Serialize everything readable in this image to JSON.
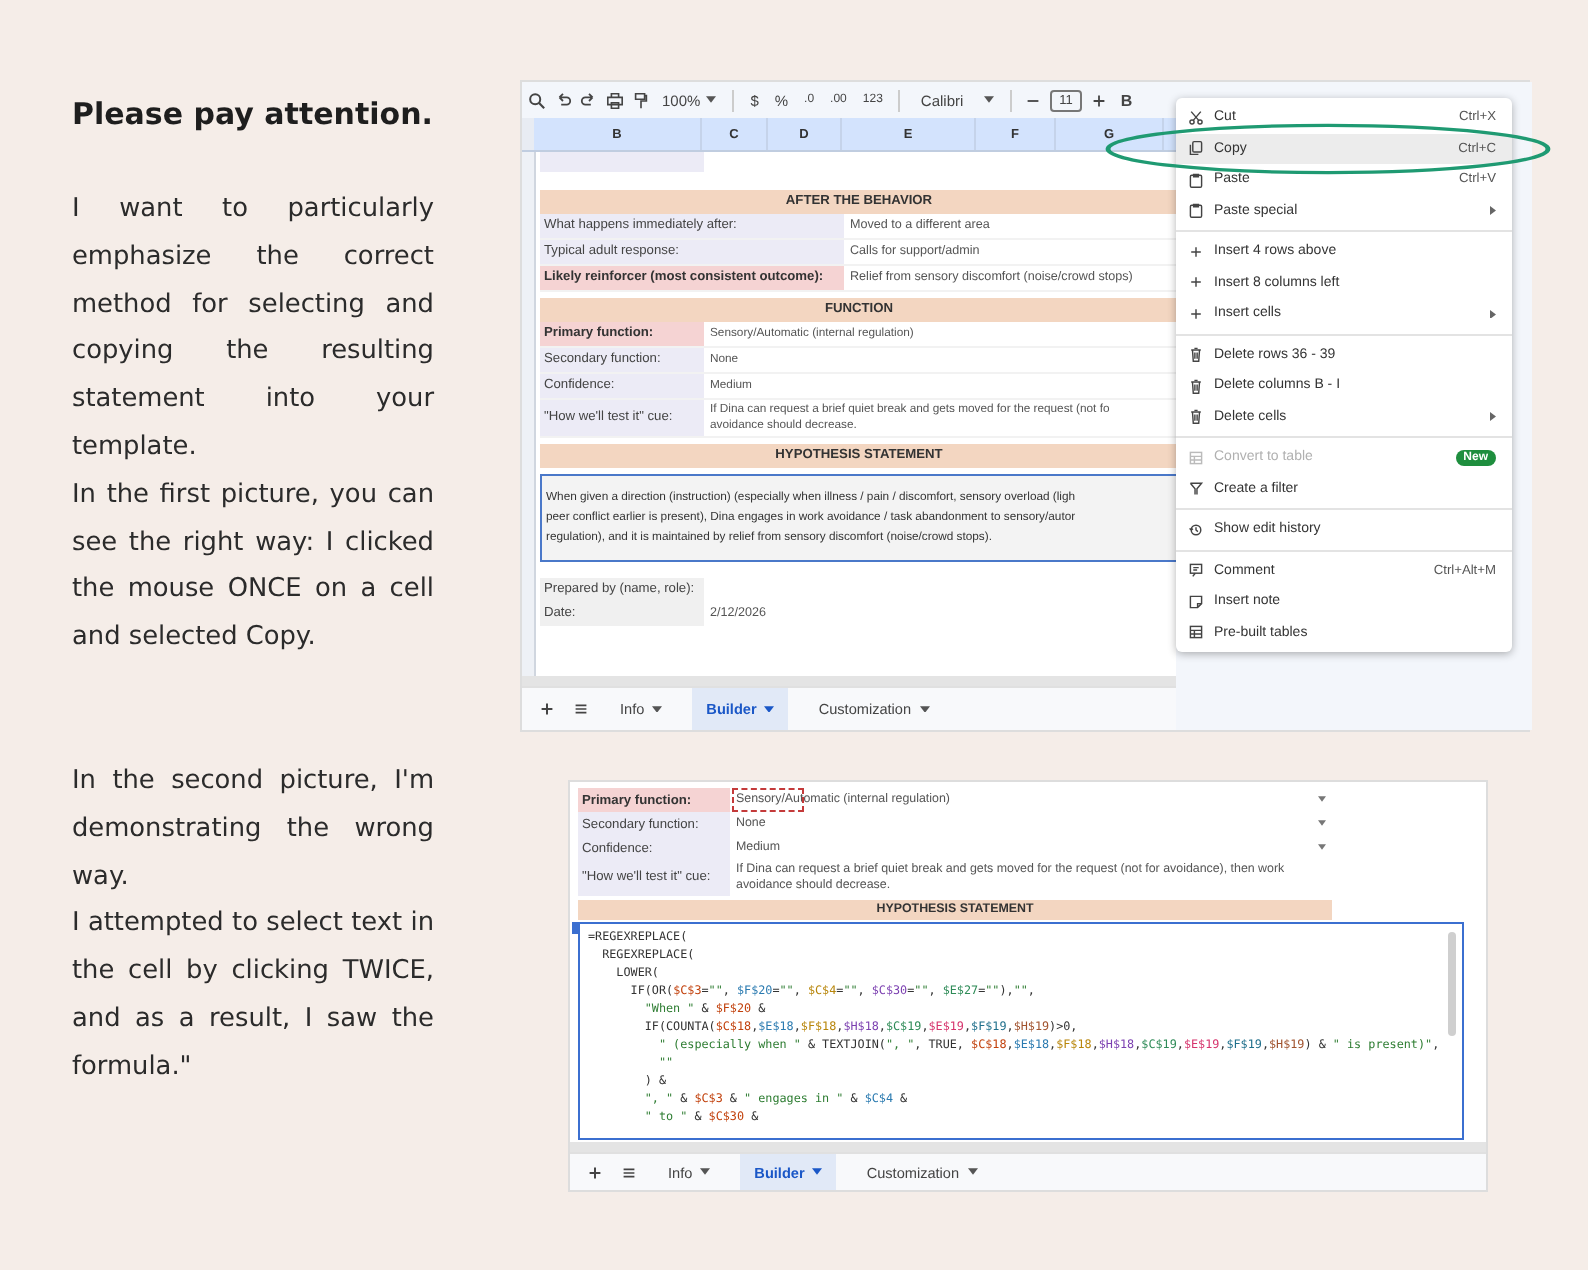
{
  "instructions_top": {
    "heading": "Please pay attention.",
    "paragraphs": [
      "I want to particularly emphasize the correct method for selecting and copying the resulting statement into your template.",
      "In the first picture, you can see the right way: I clicked the mouse ONCE on a cell and selected Copy."
    ]
  },
  "screenshot_1": {
    "toolbar": {
      "zoom": "100%",
      "currency": "$",
      "percent": "%",
      "decrease_decimals": ".0",
      "increase_decimals": ".00",
      "number_format": "123",
      "font": "Calibri",
      "font_size": "11",
      "bold": "B"
    },
    "columns": [
      "B",
      "C",
      "D",
      "E",
      "F",
      "G"
    ],
    "sections": [
      {
        "title": "AFTER THE BEHAVIOR",
        "kind": "wide",
        "rows": [
          {
            "label": "What happens immediately after:",
            "value": "Moved to a different area",
            "highlighted": false
          },
          {
            "label": "Typical adult response:",
            "value": "Calls for support/admin",
            "highlighted": false
          },
          {
            "label": "Likely reinforcer (most consistent outcome):",
            "value": "Relief from sensory discomfort (noise/crowd stops)",
            "highlighted": true
          }
        ]
      },
      {
        "title": "FUNCTION",
        "kind": "narrow",
        "rows": [
          {
            "label": "Primary function:",
            "value": "Sensory/Automatic (internal regulation)",
            "highlighted": true
          },
          {
            "label": "Secondary function:",
            "value": "None",
            "highlighted": false
          },
          {
            "label": "Confidence:",
            "value": "Medium",
            "highlighted": false
          },
          {
            "label": "\"How we'll test it\" cue:",
            "value": "If Dina can request a brief quiet break and gets moved for the request (not fo\navoidance should decrease.",
            "highlighted": false
          }
        ]
      },
      {
        "title": "HYPOTHESIS STATEMENT",
        "kind": "statement",
        "selected": true,
        "lines": [
          "When given a direction (instruction) (especially when illness / pain / discomfort, sensory overload (ligh",
          "peer conflict earlier is present), Dina engages in work avoidance / task abandonment to sensory/autor",
          "regulation), and it is maintained by relief from sensory discomfort (noise/crowd stops)."
        ]
      },
      {
        "kind": "plain",
        "rows": [
          {
            "label": "Prepared by (name, role):"
          },
          {
            "label": "Date:",
            "value": "2/12/2026"
          }
        ]
      }
    ],
    "tabs": [
      {
        "label": "Info",
        "selected": false
      },
      {
        "label": "Builder",
        "selected": true
      },
      {
        "label": "Customization",
        "selected": false
      }
    ],
    "context_menu": {
      "groups": [
        [
          {
            "kind": "cut",
            "label": "Cut",
            "shortcut": "Ctrl+X",
            "submenu": false,
            "disabled": false,
            "selected": false,
            "circled": false
          },
          {
            "kind": "copy",
            "label": "Copy",
            "shortcut": "Ctrl+C",
            "submenu": false,
            "disabled": false,
            "selected": true,
            "circled": true
          },
          {
            "kind": "paste",
            "label": "Paste",
            "shortcut": "Ctrl+V",
            "submenu": false,
            "disabled": false,
            "selected": false,
            "circled": false
          },
          {
            "kind": "paste",
            "label": "Paste special",
            "submenu": true,
            "disabled": false,
            "selected": false,
            "circled": false
          }
        ],
        [
          {
            "kind": "insert",
            "label": "Insert 4 rows above",
            "submenu": false,
            "disabled": false,
            "selected": false,
            "circled": false
          },
          {
            "kind": "insert",
            "label": "Insert 8 columns left",
            "submenu": false,
            "disabled": false,
            "selected": false,
            "circled": false
          },
          {
            "kind": "insert",
            "label": "Insert cells",
            "submenu": true,
            "disabled": false,
            "selected": false,
            "circled": false
          }
        ],
        [
          {
            "kind": "delete",
            "label": "Delete rows 36 - 39",
            "submenu": false,
            "disabled": false,
            "selected": false,
            "circled": false
          },
          {
            "kind": "delete",
            "label": "Delete columns B - I",
            "submenu": false,
            "disabled": false,
            "selected": false,
            "circled": false
          },
          {
            "kind": "delete",
            "label": "Delete cells",
            "submenu": true,
            "disabled": false,
            "selected": false,
            "circled": false
          }
        ],
        [
          {
            "kind": "table",
            "label": "Convert to table",
            "badge": "New",
            "submenu": false,
            "disabled": true,
            "selected": false,
            "circled": false
          },
          {
            "kind": "filter",
            "label": "Create a filter",
            "submenu": false,
            "disabled": false,
            "selected": false,
            "circled": false
          }
        ],
        [
          {
            "kind": "history",
            "label": "Show edit history",
            "submenu": false,
            "disabled": false,
            "selected": false,
            "circled": false
          }
        ],
        [
          {
            "kind": "comment",
            "label": "Comment",
            "shortcut": "Ctrl+Alt+M",
            "submenu": false,
            "disabled": false,
            "selected": false,
            "circled": false
          },
          {
            "kind": "note",
            "label": "Insert note",
            "submenu": false,
            "disabled": false,
            "selected": false,
            "circled": false
          },
          {
            "kind": "table",
            "label": "Pre-built tables",
            "submenu": false,
            "disabled": false,
            "selected": false,
            "circled": false
          }
        ]
      ]
    }
  },
  "instructions_bottom": {
    "paragraphs": [
      "In the second picture, I'm demonstrating the wrong way.",
      "I attempted to select text in the cell by clicking TWICE, and as a result, I saw the formula.\""
    ]
  },
  "screenshot_2": {
    "rows": [
      {
        "label": "Primary function:",
        "value": "Sensory/Automatic (internal regulation)",
        "highlighted": true,
        "dropdown": true,
        "copied": true
      },
      {
        "label": "Secondary function:",
        "value": "None",
        "highlighted": false,
        "dropdown": true,
        "copied": false
      },
      {
        "label": "Confidence:",
        "value": "Medium",
        "highlighted": false,
        "dropdown": true,
        "copied": false
      },
      {
        "label": "\"How we'll test it\" cue:",
        "value": "If Dina can request a brief quiet break and gets moved for the request (not for avoidance), then work\navoidance should decrease.",
        "highlighted": false,
        "dropdown": false,
        "copied": false
      }
    ],
    "header": "HYPOTHESIS STATEMENT",
    "formula_lines": [
      "=REGEXREPLACE(",
      "  REGEXREPLACE(",
      "    LOWER(",
      "      IF(OR($C$3=\"\", $F$20=\"\", $C$4=\"\", $C$30=\"\", $E$27=\"\"),\"\",",
      "        \"When \" & $F$20 &",
      "        IF(COUNTA($C$18,$E$18,$F$18,$H$18,$C$19,$E$19,$F$19,$H$19)>0,",
      "          \" (especially when \" & TEXTJOIN(\", \", TRUE, $C$18,$E$18,$F$18,$H$18,$C$19,$E$19,$F$19,$H$19) & \" is present)\",",
      "          \"\"",
      "        ) &",
      "        \", \" & $C$3 & \" engages in \" & $C$4 &",
      "        \" to \" & $C$30 &"
    ],
    "tabs": [
      {
        "label": "Info",
        "selected": false
      },
      {
        "label": "Builder",
        "selected": true
      },
      {
        "label": "Customization",
        "selected": false
      }
    ]
  }
}
